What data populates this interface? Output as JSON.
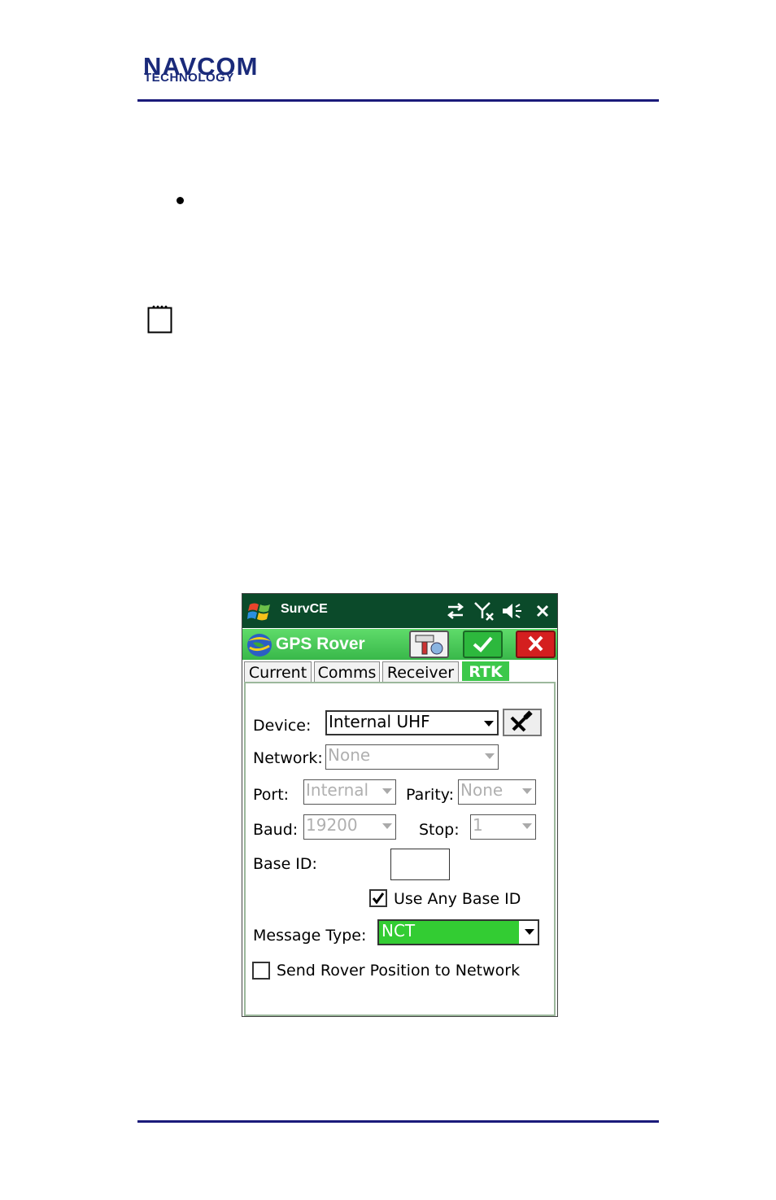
{
  "header": {
    "logo_line1": "NAVCOM",
    "logo_line2": "TECHNOLOGY"
  },
  "app": {
    "window_title": "SurvCE",
    "screen_title": "GPS Rover",
    "tabs": [
      {
        "label": "Current"
      },
      {
        "label": "Comms"
      },
      {
        "label": "Receiver"
      },
      {
        "label": "RTK",
        "active": true
      }
    ],
    "form": {
      "device_label": "Device:",
      "device_value": "Internal UHF",
      "network_label": "Network:",
      "network_value": "None",
      "port_label": "Port:",
      "port_value": "Internal",
      "parity_label": "Parity:",
      "parity_value": "None",
      "baud_label": "Baud:",
      "baud_value": "19200",
      "stop_label": "Stop:",
      "stop_value": "1",
      "base_id_label": "Base ID:",
      "base_id_value": "",
      "use_any_base_label": "Use Any Base ID",
      "use_any_base_checked": true,
      "message_type_label": "Message Type:",
      "message_type_value": "NCT",
      "send_rover_label": "Send Rover Position to Network",
      "send_rover_checked": false
    },
    "colors": {
      "title_bar": "#0b4a2a",
      "header_green": "#3cc84a",
      "selected_combo": "#33cc33",
      "cancel_red": "#d41f1f"
    },
    "icons": [
      "windows-start-icon",
      "connection-icon",
      "signal-icon",
      "speaker-icon",
      "close-icon",
      "gps-logo-icon",
      "receiver-config-icon",
      "ok-check-icon",
      "cancel-x-icon",
      "tools-icon"
    ]
  }
}
